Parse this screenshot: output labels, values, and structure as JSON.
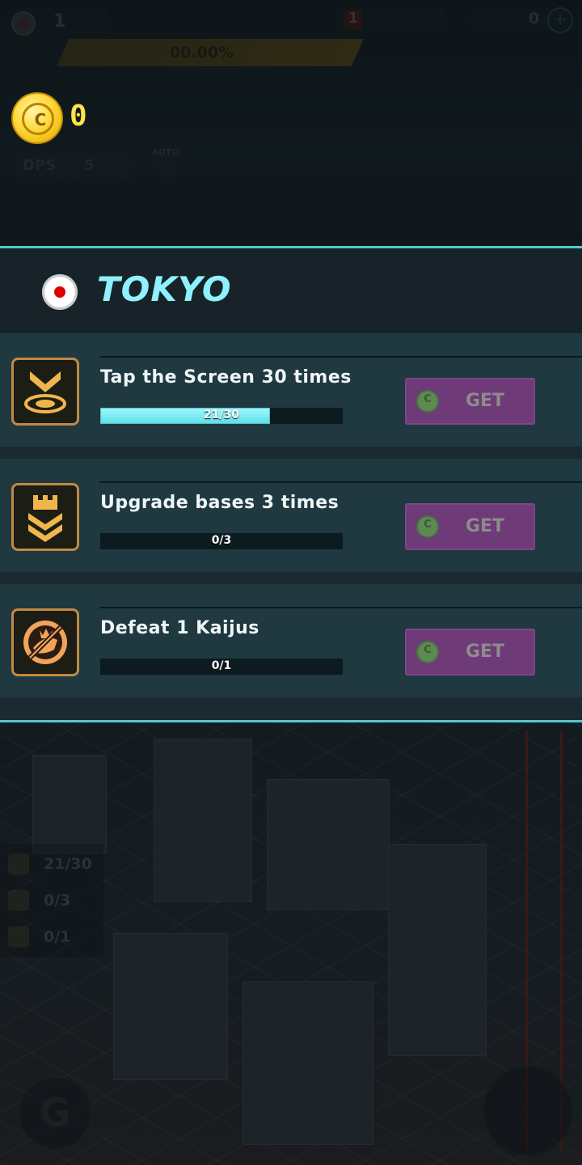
{
  "hud": {
    "level": "1",
    "progress_text": "00.00%",
    "stage_counter": "1",
    "gem_count": "0",
    "plus": "+",
    "coin_count": "0",
    "dps_label": "DPS",
    "dps_value": "5",
    "auto_label": "AUTO"
  },
  "panel": {
    "city": "TOKYO",
    "missions": [
      {
        "title": "Tap the Screen 30 times",
        "progress": "21/30",
        "fill_fraction": 0.7,
        "button_label": "GET",
        "icon": "tap-target-icon"
      },
      {
        "title": "Upgrade bases 3 times",
        "progress": "0/3",
        "fill_fraction": 0.0,
        "button_label": "GET",
        "icon": "base-upgrade-icon"
      },
      {
        "title": "Defeat 1 Kaijus",
        "progress": "0/1",
        "fill_fraction": 0.0,
        "button_label": "GET",
        "icon": "kaiju-icon"
      }
    ]
  },
  "tracker": {
    "items": [
      {
        "text": "21/30"
      },
      {
        "text": "0/3"
      },
      {
        "text": "0/1"
      }
    ]
  },
  "bottom": {
    "guild_letter": "G"
  },
  "colors": {
    "accent": "#55c8cd",
    "title": "#8ff1ff",
    "coin": "#ffe34a",
    "get_button": "#6e3a78",
    "bar_fill": "#5fe0e8"
  }
}
